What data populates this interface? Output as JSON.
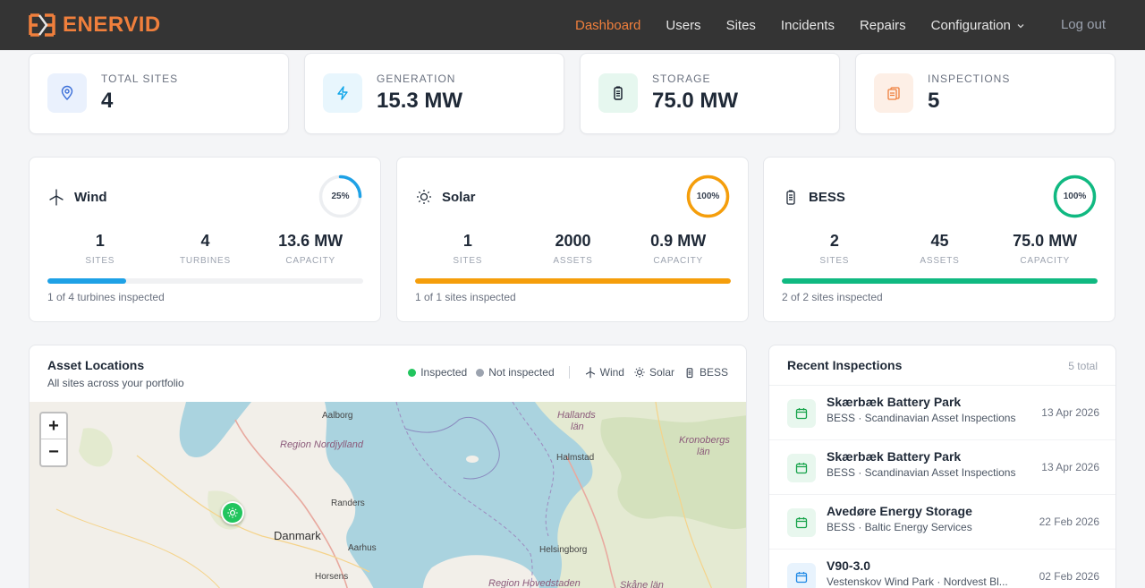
{
  "nav": {
    "brand": "ENERVID",
    "items": [
      {
        "label": "Dashboard",
        "active": true
      },
      {
        "label": "Users"
      },
      {
        "label": "Sites"
      },
      {
        "label": "Incidents"
      },
      {
        "label": "Repairs"
      },
      {
        "label": "Configuration",
        "dropdown": true
      }
    ],
    "logout": "Log out"
  },
  "stats": [
    {
      "label": "TOTAL SITES",
      "value": "4",
      "icon": "map-pin-icon",
      "color": "#3b6fd8"
    },
    {
      "label": "GENERATION",
      "value": "15.3 MW",
      "icon": "lightning-icon",
      "color": "#0ea5e9"
    },
    {
      "label": "STORAGE",
      "value": "75.0 MW",
      "icon": "battery-icon",
      "color": "#111827"
    },
    {
      "label": "INSPECTIONS",
      "value": "5",
      "icon": "clipboard-icon",
      "color": "#f07f3c"
    }
  ],
  "categories": [
    {
      "title": "Wind",
      "icon": "wind-turbine-icon",
      "percent": "25%",
      "ring": 0.25,
      "color": "#1ea1e6",
      "metrics": [
        {
          "n": "1",
          "u": "SITES"
        },
        {
          "n": "4",
          "u": "TURBINES"
        },
        {
          "n": "13.6 MW",
          "u": "CAPACITY"
        }
      ],
      "progress": 0.25,
      "foot": "1 of 4 turbines inspected"
    },
    {
      "title": "Solar",
      "icon": "sun-icon",
      "percent": "100%",
      "ring": 1.0,
      "color": "#f59e0b",
      "metrics": [
        {
          "n": "1",
          "u": "SITES"
        },
        {
          "n": "2000",
          "u": "ASSETS"
        },
        {
          "n": "0.9 MW",
          "u": "CAPACITY"
        }
      ],
      "progress": 1.0,
      "foot": "1 of 1 sites inspected"
    },
    {
      "title": "BESS",
      "icon": "battery-icon",
      "percent": "100%",
      "ring": 1.0,
      "color": "#10b981",
      "metrics": [
        {
          "n": "2",
          "u": "SITES"
        },
        {
          "n": "45",
          "u": "ASSETS"
        },
        {
          "n": "75.0 MW",
          "u": "CAPACITY"
        }
      ],
      "progress": 1.0,
      "foot": "2 of 2 sites inspected"
    }
  ],
  "map": {
    "title": "Asset Locations",
    "subtitle": "All sites across your portfolio",
    "legend": {
      "inspected": "Inspected",
      "not_inspected": "Not inspected",
      "wind": "Wind",
      "solar": "Solar",
      "bess": "BESS"
    },
    "labels": {
      "aalborg": "Aalborg",
      "nordjylland": "Region Nordjylland",
      "randers": "Randers",
      "danmark": "Danmark",
      "aarhus": "Aarhus",
      "horsens": "Horsens",
      "hallands": "Hallands",
      "hallands2": "län",
      "halmstad": "Halmstad",
      "kronobergs": "Kronobergs",
      "kronobergs2": "län",
      "helsingborg": "Helsingborg",
      "hovedstaden": "Region Hovedstaden",
      "skane": "Skåne län"
    },
    "zoom_in": "+",
    "zoom_out": "−"
  },
  "recent": {
    "title": "Recent Inspections",
    "total": "5 total",
    "items": [
      {
        "name": "Skærbæk Battery Park",
        "sub": "BESS · Scandinavian Asset Inspections",
        "date": "13 Apr 2026"
      },
      {
        "name": "Skærbæk Battery Park",
        "sub": "BESS · Scandinavian Asset Inspections",
        "date": "13 Apr 2026"
      },
      {
        "name": "Avedøre Energy Storage",
        "sub": "BESS · Baltic Energy Services",
        "date": "22 Feb 2026"
      },
      {
        "name": "V90-3.0",
        "sub": "Vestenskov Wind Park · Nordvest Bl...",
        "date": "02 Feb 2026"
      }
    ]
  }
}
